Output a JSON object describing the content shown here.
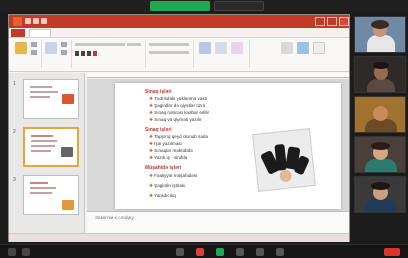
{
  "slide": {
    "sections": [
      {
        "title": "Sinaq işləri",
        "bullets": [
          "Tədrisdəki yüklənmə vaxtı",
          "Şagirdlər də qiyətlər üzrə",
          "Sınaq nəticəsi kəsbar edilir",
          "Sınaq və qiyməti yazılır"
        ]
      },
      {
        "title": "Sınaq işləri",
        "bullets": [
          "Tapşırıq qeyd olunub sadə",
          "İşin yazılması",
          "Sınaqlar məktəbdə",
          "Yazılı iş - sinifdə"
        ]
      },
      {
        "title": "Müşahidə işləri",
        "bullets": [
          "Fəaliyyət müşahidəsi",
          "Şagirdin iştirakı",
          "Yaradıcılıq"
        ]
      }
    ]
  },
  "notes": {
    "placeholder": "Заметки к слайду"
  },
  "thumbnails": [
    {
      "number": "1"
    },
    {
      "number": "2"
    },
    {
      "number": "3"
    }
  ],
  "participants": [
    {
      "name": ""
    },
    {
      "name": ""
    },
    {
      "name": ""
    },
    {
      "name": ""
    },
    {
      "name": ""
    }
  ],
  "icons": {
    "ppt_logo": "powerpoint-icon",
    "mic": "microphone-icon",
    "video": "camera-icon",
    "share": "share-screen-icon",
    "end": "end-meeting-icon"
  },
  "colors": {
    "ppt_brand": "#c23b2a",
    "zoom_share": "#23a651",
    "zoom_end": "#d9352b"
  }
}
